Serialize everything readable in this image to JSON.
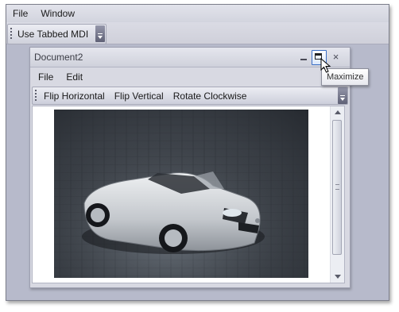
{
  "app": {
    "menu": [
      "File",
      "Window"
    ],
    "toolbar": {
      "use_tabbed_mdi_label": "Use Tabbed MDI"
    }
  },
  "child_window": {
    "title": "Document2",
    "close_glyph": "×",
    "menu": [
      "File",
      "Edit"
    ],
    "toolbar": [
      "Flip Horizontal",
      "Flip Vertical",
      "Rotate Clockwise"
    ]
  },
  "tooltip": {
    "text": "Maximize"
  },
  "icons": {
    "minimize": "minimize-icon",
    "maximize": "maximize-icon",
    "close": "close-icon",
    "cursor": "mouse-pointer-icon",
    "toolbar_overflow": "chevron-down-icon"
  },
  "colors": {
    "mdi_background": "#b7bacb",
    "maximize_hover_border": "#3c6fc4",
    "paving": "#3c4148",
    "car_body": "#cfd2d6"
  }
}
